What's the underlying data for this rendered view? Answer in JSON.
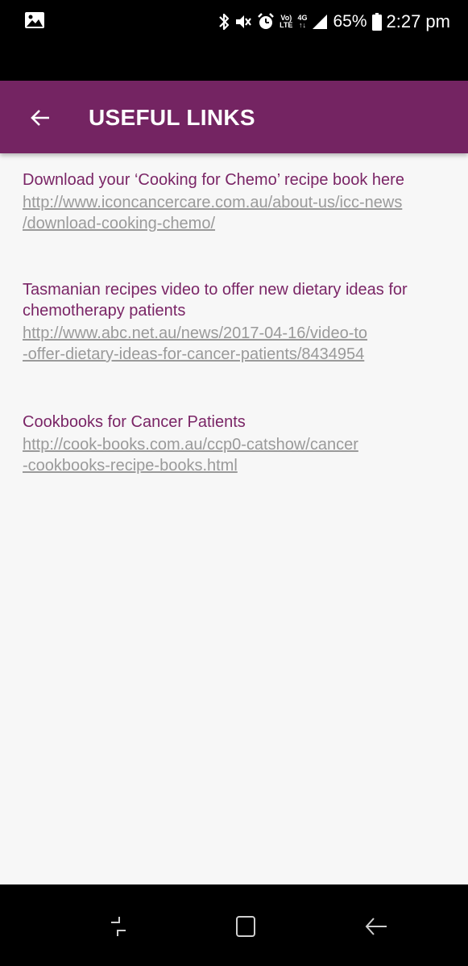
{
  "status_bar": {
    "left_icon": "image-notification-icon",
    "icons": [
      "bluetooth-icon",
      "mute-icon",
      "alarm-icon",
      "volte-icon",
      "4g-icon",
      "signal-icon"
    ],
    "volte_top": "Vo)",
    "volte_bottom": "LTE",
    "network_label": "4G",
    "battery_percent": "65%",
    "time": "2:27 pm"
  },
  "app_bar": {
    "title": "USEFUL LINKS",
    "background_color": "#742462"
  },
  "links": [
    {
      "title": "Download your ‘Cooking for Chemo’ recipe book here",
      "url_line1": "http://www.iconcancercare.com.au/about-us/icc-news",
      "url_line2": "/download-cooking-chemo/"
    },
    {
      "title_line1": "Tasmanian recipes video to offer new dietary ideas for",
      "title_line2": "chemotherapy patients",
      "url_line1": "http://www.abc.net.au/news/2017-04-16/video-to",
      "url_line2": "-offer-dietary-ideas-for-cancer-patients/8434954"
    },
    {
      "title": "Cookbooks for Cancer Patients",
      "url_line1": "http://cook-books.com.au/ccp0-catshow/cancer",
      "url_line2": "-cookbooks-recipe-books.html"
    }
  ],
  "nav_bar": {
    "buttons": [
      "recents-icon",
      "home-icon",
      "back-icon"
    ]
  },
  "colors": {
    "accent": "#742462",
    "link_title": "#7a2566",
    "link_url": "#9a9a9a",
    "background": "#f7f7f7"
  }
}
